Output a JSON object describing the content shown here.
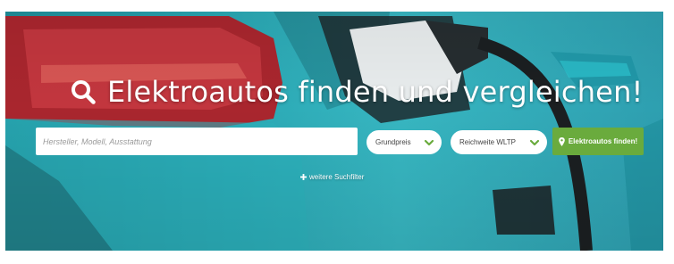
{
  "hero": {
    "title": "Elektroautos finden und vergleichen!",
    "title_icon": "search-icon"
  },
  "search": {
    "placeholder": "Hersteller, Modell, Ausstattung",
    "value": ""
  },
  "filters": {
    "grundpreis_label": "Grundpreis",
    "reichweite_label": "Reichweite WLTP",
    "chevron_icon": "chevron-down-icon"
  },
  "find_button": {
    "label": "Elektroautos finden!",
    "icon": "map-pin-icon"
  },
  "more_filters": {
    "label": "weitere Suchfilter",
    "icon": "plus-icon"
  },
  "colors": {
    "accent_green": "#6aab3d",
    "background_teal": "#2aa8b4",
    "chevron_green": "#6aab3d"
  }
}
